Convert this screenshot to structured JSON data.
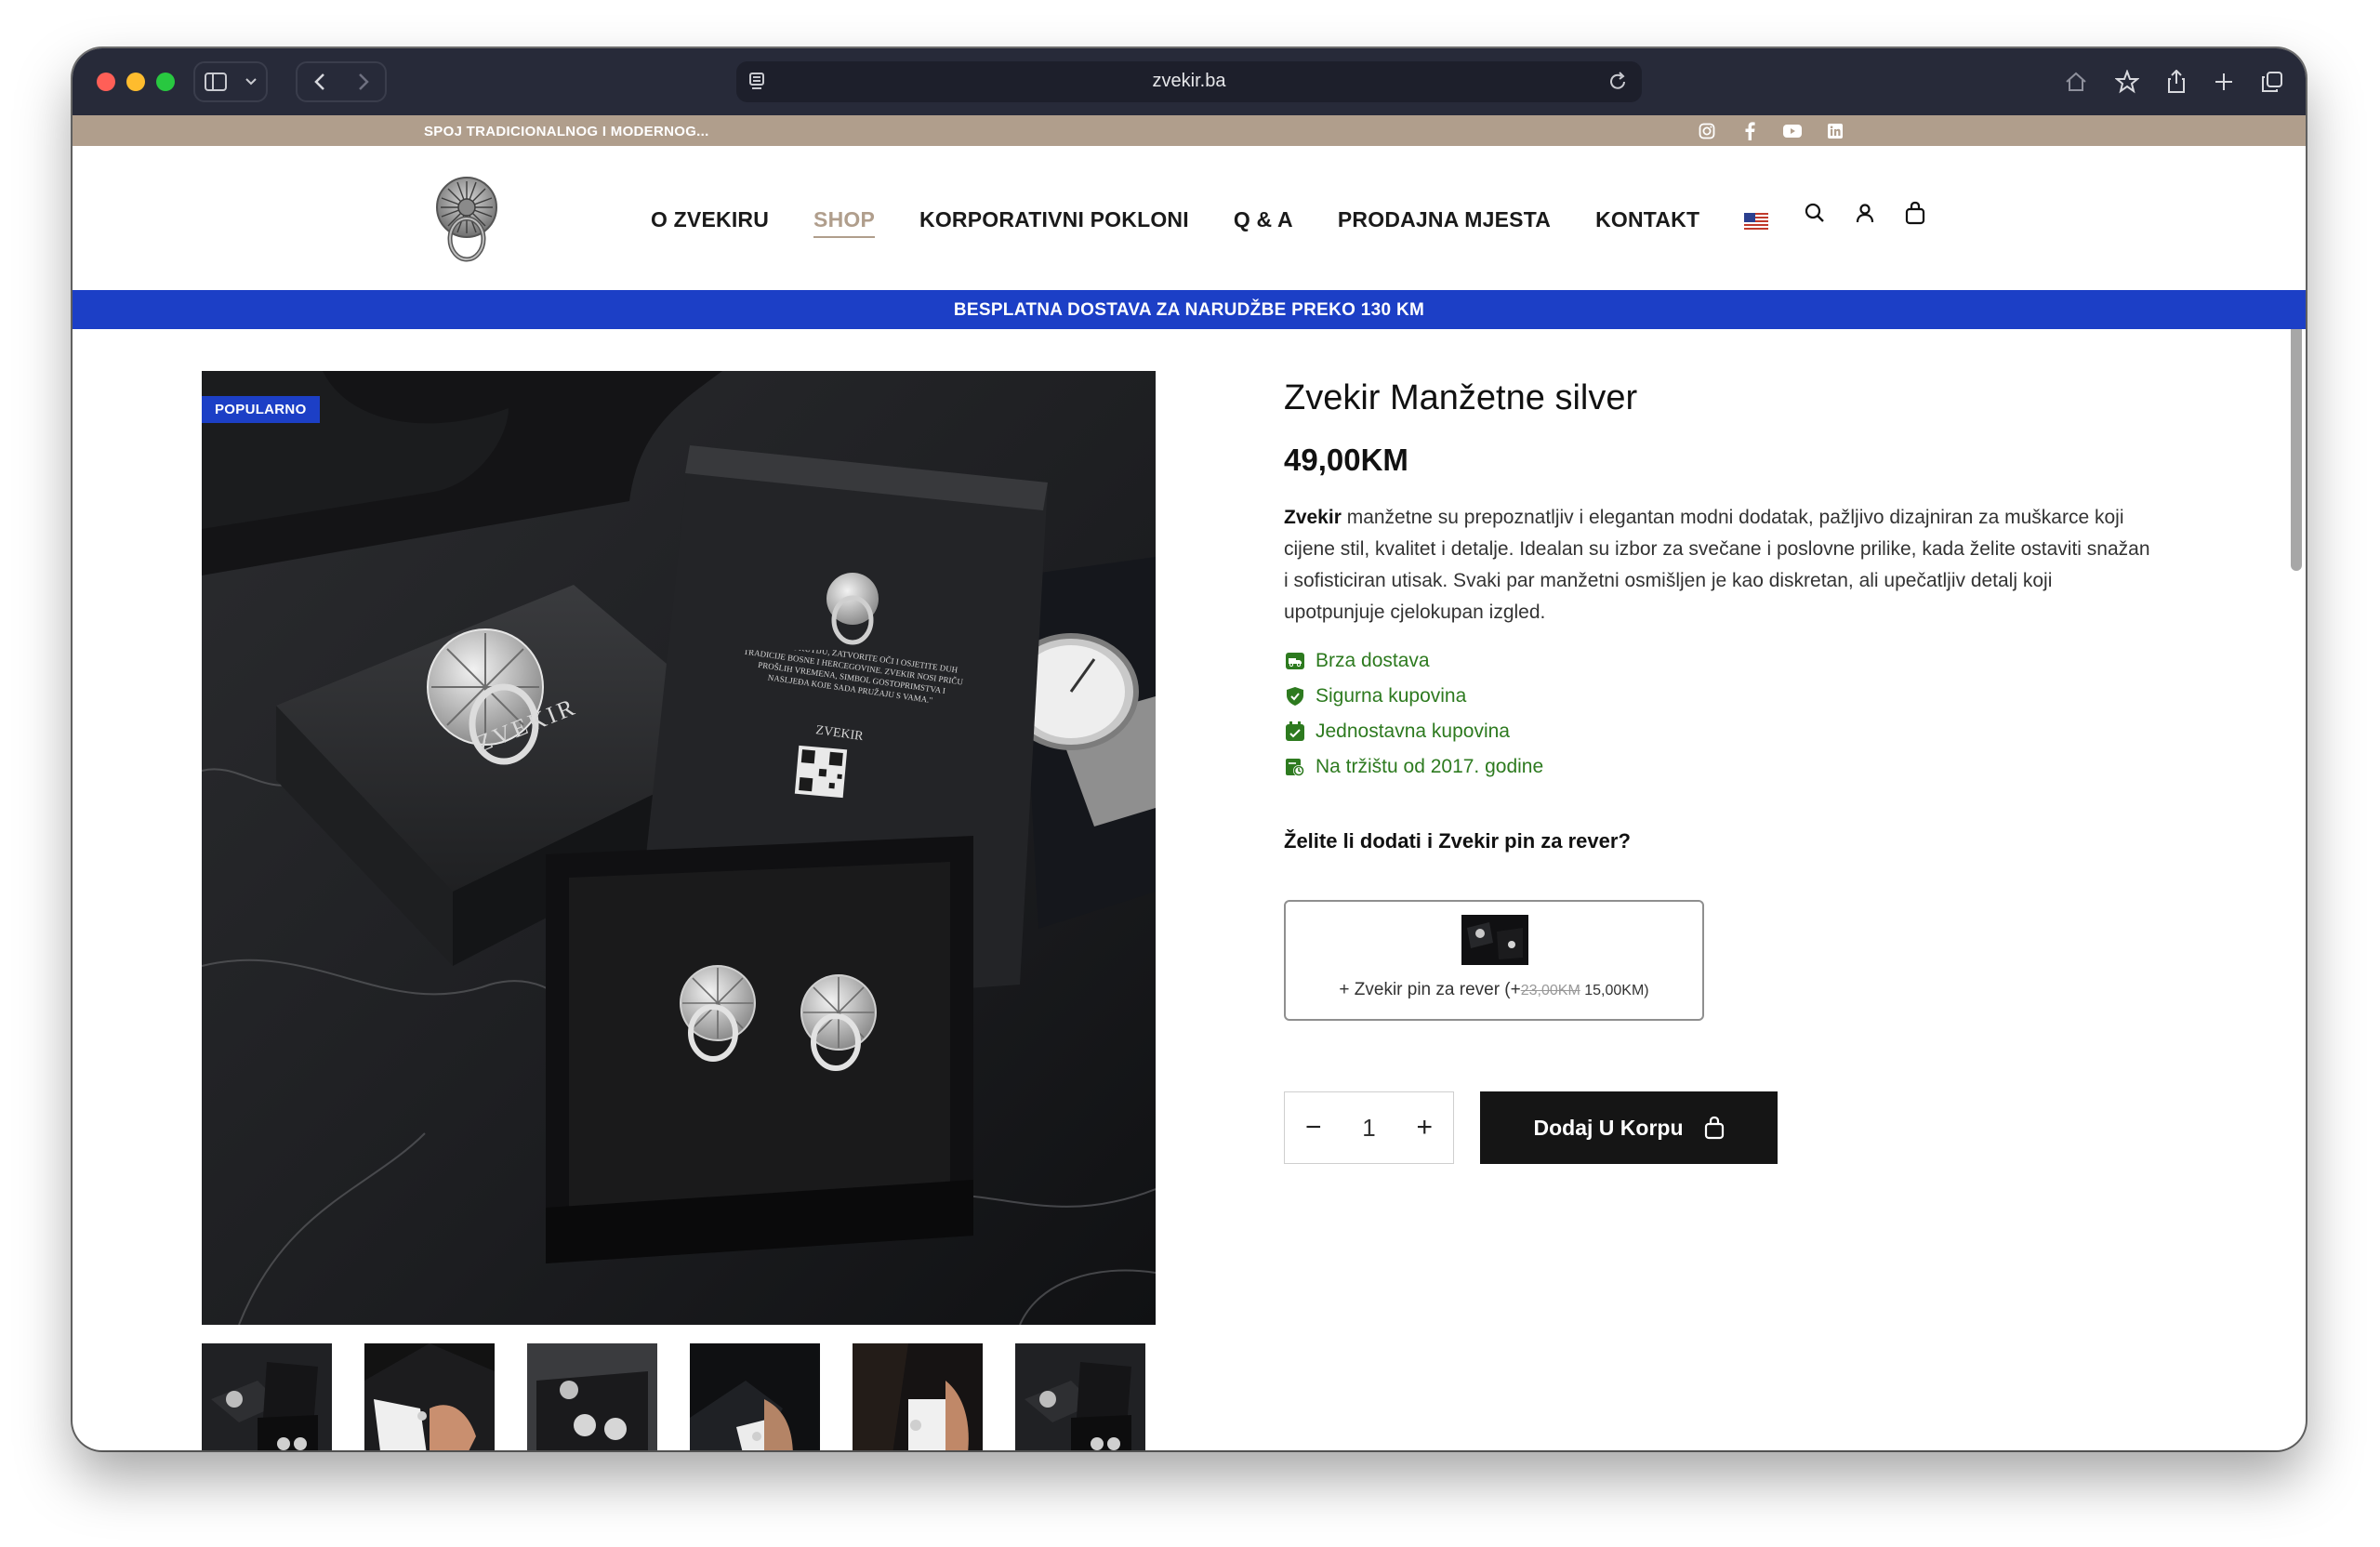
{
  "browser": {
    "url": "zvekir.ba"
  },
  "topbar": {
    "slogan": "SPOJ TRADICIONALNOG I MODERNOG...",
    "social_icons": [
      "instagram-icon",
      "facebook-icon",
      "youtube-icon",
      "linkedin-icon"
    ]
  },
  "nav": {
    "items": [
      {
        "label": "O ZVEKIRU",
        "active": false
      },
      {
        "label": "SHOP",
        "active": true
      },
      {
        "label": "KORPORATIVNI POKLONI",
        "active": false
      },
      {
        "label": "Q & A",
        "active": false
      },
      {
        "label": "PRODAJNA MJESTA",
        "active": false
      },
      {
        "label": "KONTAKT",
        "active": false
      }
    ],
    "language_icon": "us-flag-icon",
    "icons": [
      "search-icon",
      "user-icon",
      "bag-icon"
    ]
  },
  "shipping_banner": "BESPLATNA DOSTAVA ZA NARUDŽBE PREKO 130 KM",
  "product": {
    "badge": "POPULARNO",
    "title": "Zvekir Manžetne silver",
    "price": "49,00KM",
    "desc_brand": "Zvekir",
    "description": " manžetne su prepoznatljiv i elegantan modni dodatak, pažljivo dizajniran za muškarce koji cijene stil, kvalitet i detalje. Idealan su izbor za svečane i poslovne prilike, kada želite ostaviti snažan i sofisticiran utisak. Svaki par manžetni osmišljen je kao diskretan, ali upečatljiv detalj koji upotpunjuje cjelokupan izgled.",
    "features": [
      "Brza dostava",
      "Sigurna kupovina",
      "Jednostavna kupovina",
      "Na tržištu od 2017. godine"
    ],
    "addon_question": "Želite li dodati i Zvekir pin za rever?",
    "addon": {
      "label": "+ Zvekir pin za rever (+",
      "old_price": "23,00KM",
      "new_price": " 15,00KM)"
    },
    "quantity": "1",
    "minus": "−",
    "plus": "+",
    "add_to_cart": "Dodaj U Korpu",
    "box_text": "\"OTVORITE KUTIJU, ZATVORITE OČI I OSJETITE DUH TRADICIJE BOSNE I HERCEGOVINE. ZVEKIR NOSI PRIČU PROŠLIH VREMENA, SIMBOL GOSTOPRIMSTVA I NASLJEĐA KOJE SADA PRUŽAJU S VAMA.\"",
    "box_brand": "ZVEKIR"
  },
  "colors": {
    "topbar": "#b09e8c",
    "banner": "#1c3fc6",
    "feature_green": "#2d7a1f",
    "button": "#151515"
  }
}
